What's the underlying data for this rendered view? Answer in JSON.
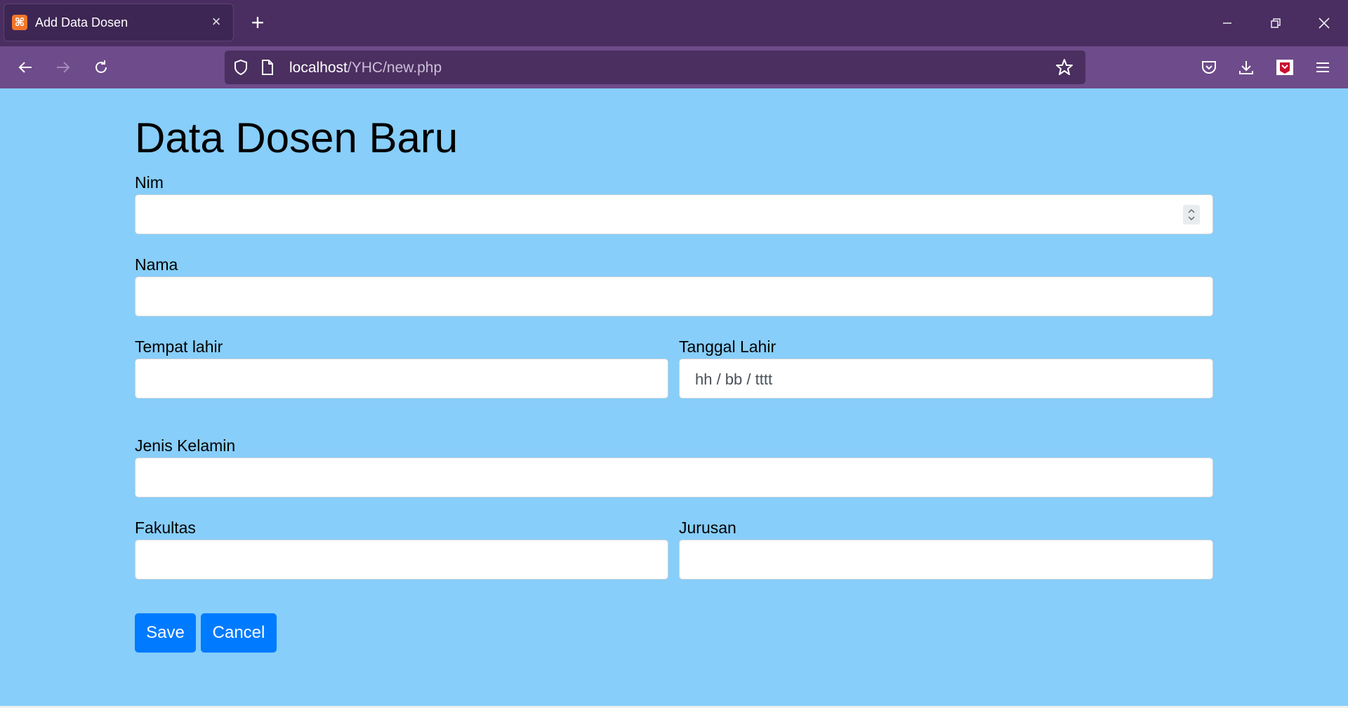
{
  "browser": {
    "tab": {
      "title": "Add Data Dosen",
      "favicon": "xampp-icon"
    },
    "url": {
      "host": "localhost",
      "path": "/YHC/new.php"
    },
    "colors": {
      "tabbar": "#4a2d61",
      "toolbar": "#6e4b8a"
    }
  },
  "page": {
    "title": "Data Dosen Baru",
    "background": "#87cefa",
    "fields": {
      "nim": {
        "label": "Nim",
        "value": ""
      },
      "nama": {
        "label": "Nama",
        "value": ""
      },
      "tempat_lahir": {
        "label": "Tempat lahir",
        "value": ""
      },
      "tanggal_lahir": {
        "label": "Tanggal Lahir",
        "placeholder": "hh / bb / tttt"
      },
      "jenis_kelamin": {
        "label": "Jenis Kelamin",
        "value": ""
      },
      "fakultas": {
        "label": "Fakultas",
        "value": ""
      },
      "jurusan": {
        "label": "Jurusan",
        "value": ""
      }
    },
    "buttons": {
      "save": "Save",
      "cancel": "Cancel"
    },
    "accent": "#007bff"
  }
}
